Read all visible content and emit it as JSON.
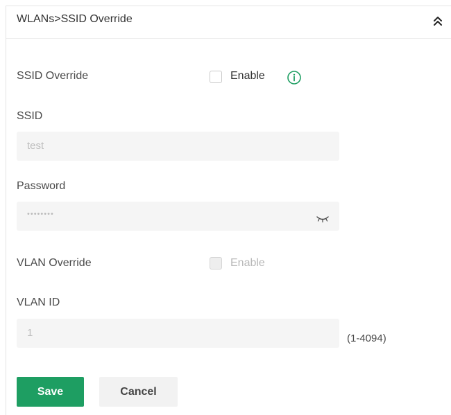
{
  "header": {
    "title": "WLANs>SSID Override",
    "collapse_icon": "double-chevron-up-icon"
  },
  "ssid_override": {
    "label": "SSID Override",
    "checkbox_label": "Enable",
    "checked": false,
    "info_icon": "info-circle-icon"
  },
  "ssid": {
    "label": "SSID",
    "value": "test"
  },
  "password": {
    "label": "Password",
    "value": "••••••••",
    "eye_icon": "eye-closed-icon"
  },
  "vlan_override": {
    "label": "VLAN Override",
    "checkbox_label": "Enable",
    "checked": false,
    "disabled": true
  },
  "vlan_id": {
    "label": "VLAN ID",
    "value": "1",
    "range_hint": "(1-4094)"
  },
  "actions": {
    "save_label": "Save",
    "cancel_label": "Cancel"
  },
  "colors": {
    "primary": "#1e9e62",
    "info": "#1e9e62",
    "input_bg": "#f5f5f5"
  }
}
